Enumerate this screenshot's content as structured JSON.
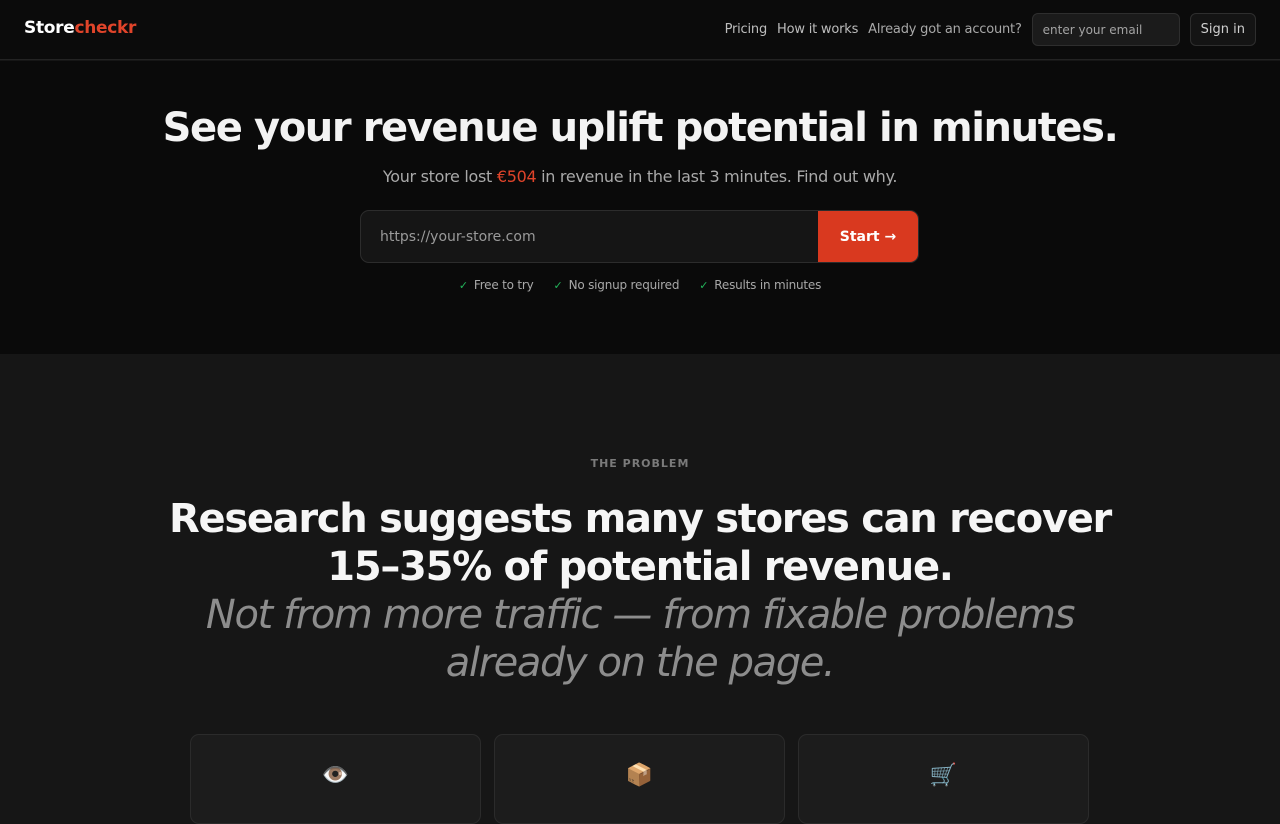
{
  "header": {
    "logo_part1": "Store",
    "logo_part2": "checkr",
    "nav": {
      "pricing": "Pricing",
      "how_it_works": "How it works",
      "account_prompt": "Already got an account?",
      "email_placeholder": "enter your email",
      "signin_label": "Sign in"
    }
  },
  "hero": {
    "title": "See your revenue uplift potential in minutes.",
    "subtitle_before": "Your store lost ",
    "subtitle_amount": "€504",
    "subtitle_after": " in revenue in the last 3 minutes. Find out why.",
    "url_placeholder": "https://your-store.com",
    "start_label": "Start →",
    "checks": [
      {
        "icon": "checkmark-icon",
        "symbol": "✓",
        "label": "Free to try"
      },
      {
        "icon": "checkmark-icon",
        "symbol": "✓",
        "label": "No signup required"
      },
      {
        "icon": "checkmark-icon",
        "symbol": "✓",
        "label": "Results in minutes"
      }
    ]
  },
  "problem": {
    "eyebrow": "THE PROBLEM",
    "headline_line1": "Research suggests many stores can recover",
    "headline_line2": "15–35% of potential revenue.",
    "subheadline_line1": "Not from more traffic — from fixable problems",
    "subheadline_line2": "already on the page.",
    "cards": [
      {
        "icon": "eye-icon",
        "glyph": "👁️"
      },
      {
        "icon": "package-icon",
        "glyph": "📦"
      },
      {
        "icon": "shopping-cart-icon",
        "glyph": "🛒"
      }
    ]
  },
  "colors": {
    "accent": "#e0442a",
    "button": "#d9391f",
    "check": "#22b45a",
    "hero_bg": "#0a0a0a",
    "section_bg": "#161616"
  }
}
